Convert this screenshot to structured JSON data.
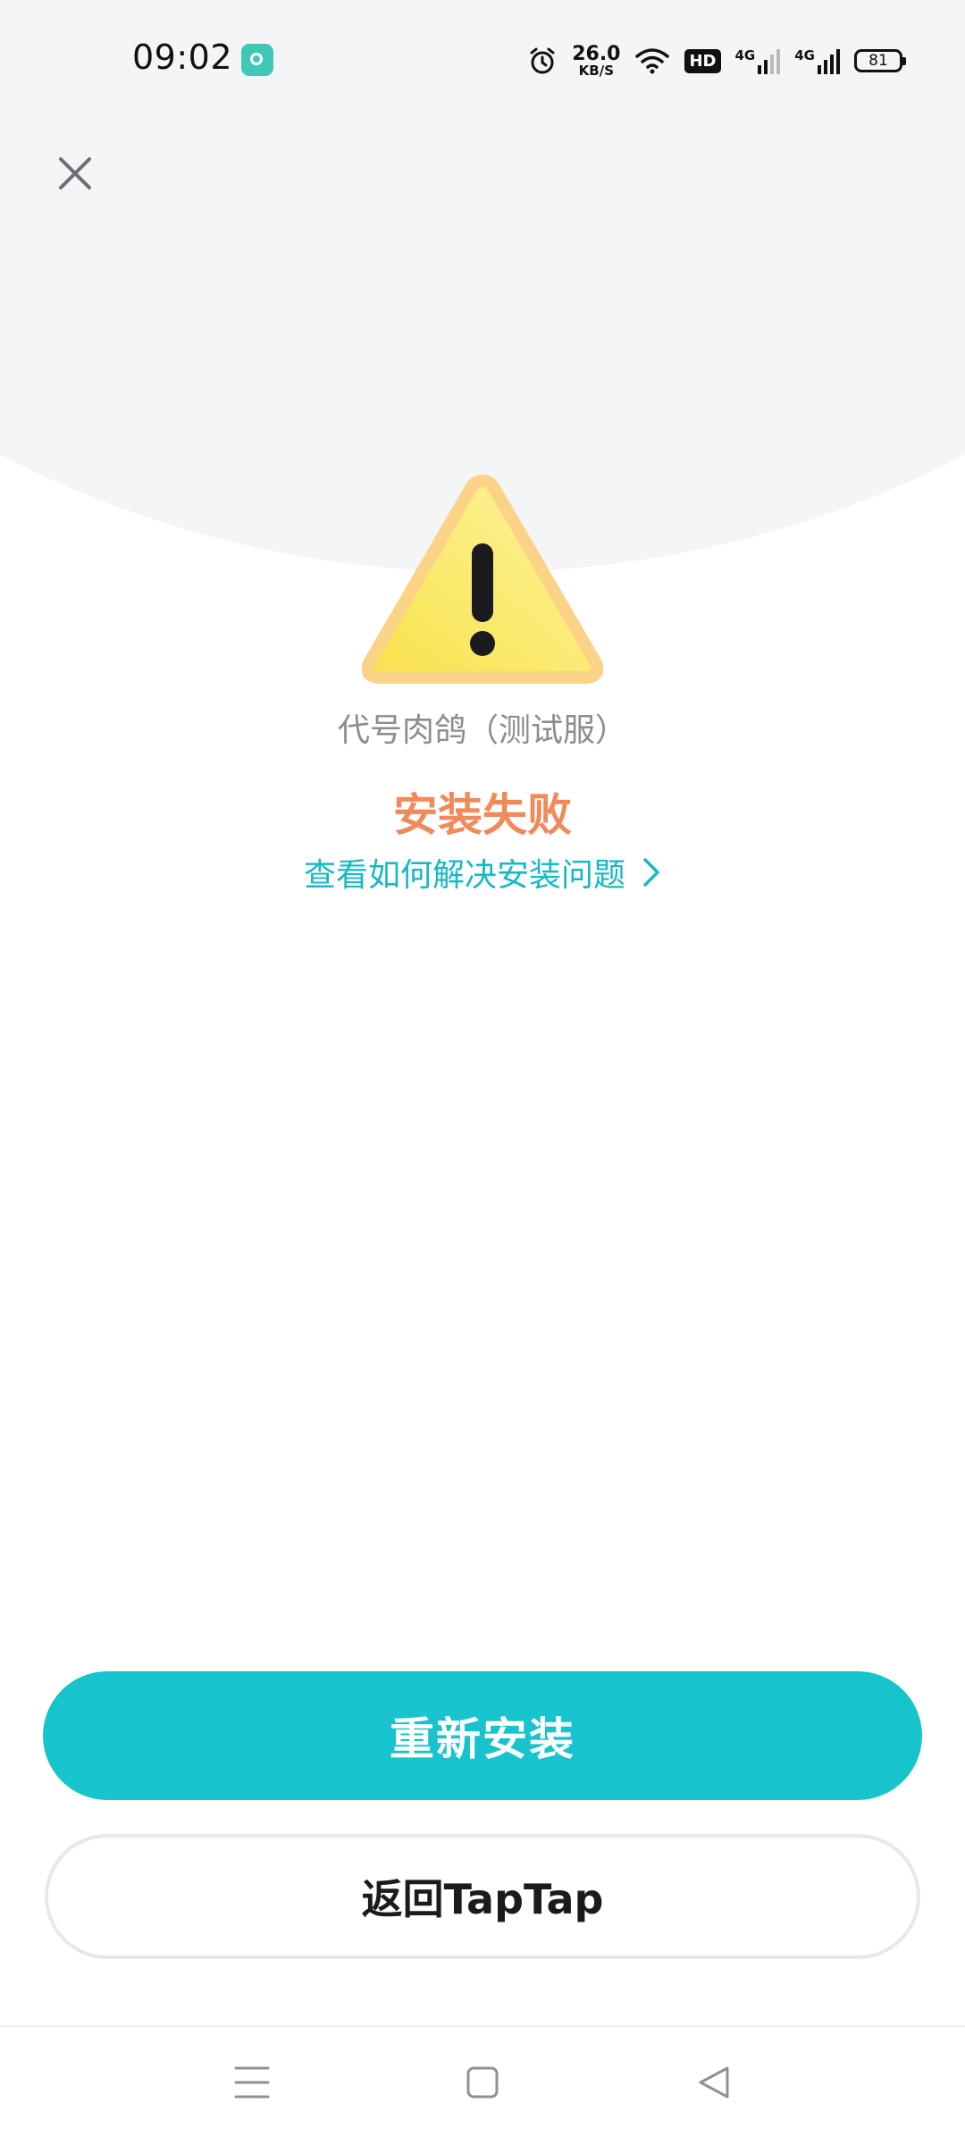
{
  "status_bar": {
    "time": "09:02",
    "net_speed_value": "26.0",
    "net_speed_unit": "KB/S",
    "hd_label": "HD",
    "signal1_label": "4G",
    "signal2_label": "4G",
    "battery_level": "81"
  },
  "install_result": {
    "app_name": "代号肉鸽（测试服）",
    "status_title": "安装失败",
    "help_link_label": "查看如何解决安装问题"
  },
  "actions": {
    "reinstall_label": "重新安装",
    "back_label": "返回TapTap"
  },
  "colors": {
    "accent": "#17c3cc",
    "error": "#f08a5b",
    "link": "#18b8c4",
    "warning_yellow": "#fbe24a"
  },
  "icons": {
    "close": "close-icon",
    "warning": "warning-triangle-icon",
    "chevron": "chevron-right-icon",
    "nav_menu": "menu-icon",
    "nav_home": "home-square-icon",
    "nav_back": "back-triangle-icon"
  }
}
